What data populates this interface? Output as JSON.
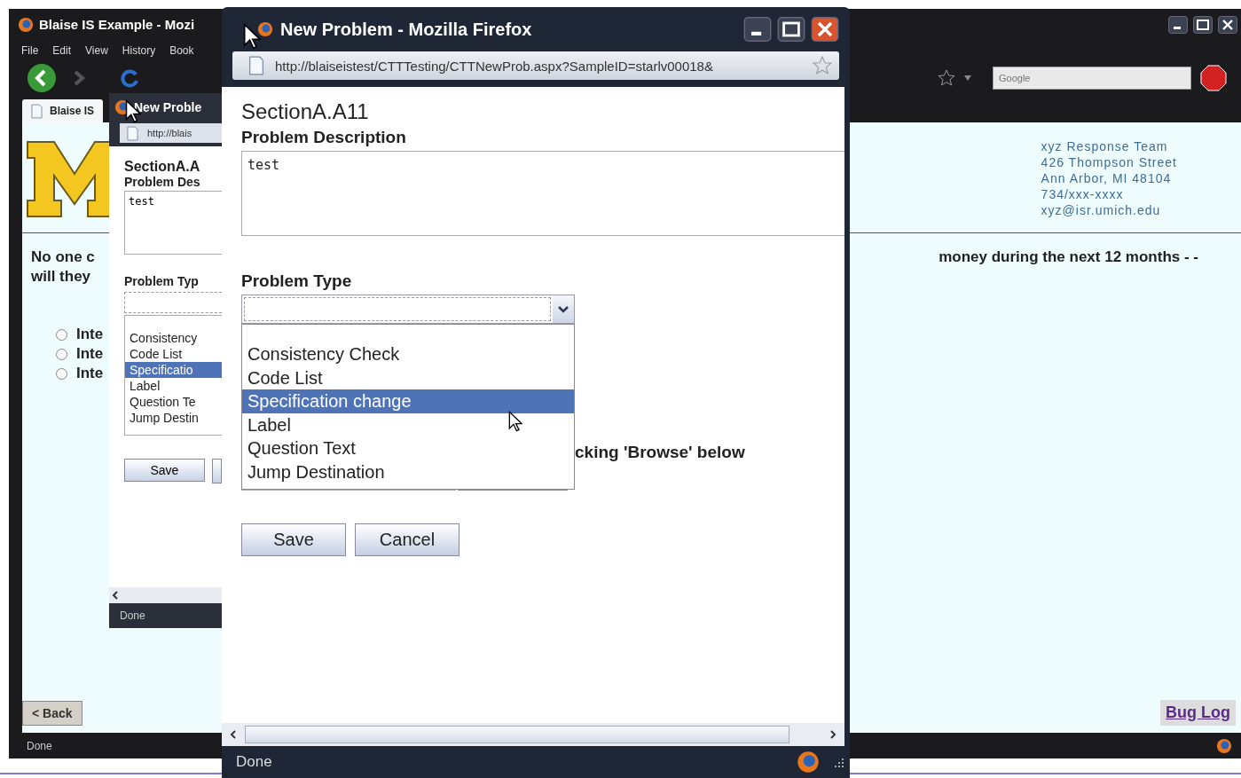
{
  "browser": {
    "title": "Blaise IS Example - Mozi",
    "menu": [
      "File",
      "Edit",
      "View",
      "History",
      "Book"
    ],
    "search_placeholder": "Google",
    "tabs": [
      {
        "label": "Blaise IS",
        "selected": true
      }
    ],
    "contact": [
      "xyz Response Team",
      "426 Thompson Street",
      "Ann Arbor, MI 48104",
      "734/xxx-xxxx",
      "xyz@isr.umich.edu"
    ],
    "question_left": [
      "No one c",
      "will they"
    ],
    "question_right": "money during the next 12 months - -",
    "options": [
      {
        "label": "Inte",
        "selected": false
      },
      {
        "label": "Inte",
        "selected": false
      },
      {
        "label": "Inte",
        "selected": false
      }
    ],
    "back_button": "< Back",
    "bug_log": "Bug Log",
    "status": "Done"
  },
  "popup_behind": {
    "title": "New Proble",
    "url": "http://blais",
    "section": "SectionA.A",
    "description_label": "Problem Des",
    "description": "test",
    "type_label": "Problem Typ",
    "type_options": [
      {
        "label": "Consistency",
        "selected": false
      },
      {
        "label": "Code List",
        "selected": false
      },
      {
        "label": "Specificatio",
        "selected": true
      },
      {
        "label": "Label",
        "selected": false
      },
      {
        "label": "Question Te",
        "selected": false
      },
      {
        "label": "Jump Destin",
        "selected": false
      }
    ],
    "buttons": [
      "Save"
    ],
    "status": "Done"
  },
  "popup": {
    "title": "New Problem - Mozilla Firefox",
    "url": "http://blaiseistest/CTTTesting/CTTNewProb.aspx?SampleID=starlv00018&",
    "section": "SectionA.A11",
    "description_label": "Problem Description",
    "description": "test",
    "type_label": "Problem Type",
    "dropdown_expanded": true,
    "type_options": [
      {
        "label": "Consistency Check",
        "selected": false
      },
      {
        "label": "Code List",
        "selected": false
      },
      {
        "label": "Specification change",
        "selected": true
      },
      {
        "label": "Label",
        "selected": false
      },
      {
        "label": "Question Text",
        "selected": false
      },
      {
        "label": "Jump Destination",
        "selected": false
      }
    ],
    "browse_hint": "cking 'Browse' below",
    "buttons": [
      "Save",
      "Cancel"
    ],
    "status": "Done"
  }
}
